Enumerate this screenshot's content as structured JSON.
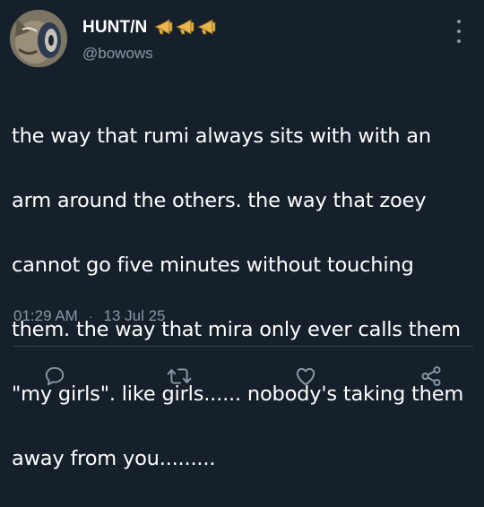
{
  "author": {
    "display_name": "HUNT/N",
    "handle": "@bowows",
    "badge_icons": [
      "megaphone-icon",
      "megaphone-icon",
      "megaphone-icon"
    ]
  },
  "tweet": {
    "lines": [
      "the way that rumi always sits with with an",
      "arm around the others. the way that zoey",
      "cannot go five minutes without touching",
      "them. the way that mira only ever calls them",
      "\"my girls\". like girls...... nobody's taking them",
      "away from you........."
    ],
    "time": "01:29 AM",
    "separator": "·",
    "date": "13 Jul 25"
  },
  "actions": [
    "reply-icon",
    "retweet-icon",
    "like-icon",
    "share-icon"
  ],
  "colors": {
    "background": "#15202b",
    "primary_text": "#ffffff",
    "secondary_text": "#8899a6",
    "divider": "#38444d",
    "badge": "#e8b64b"
  }
}
